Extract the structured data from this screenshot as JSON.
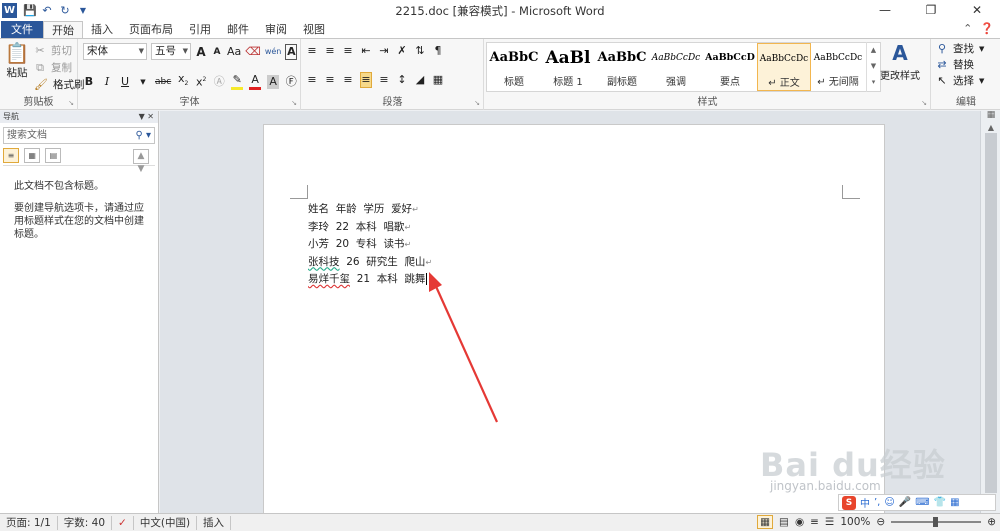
{
  "window": {
    "title": "2215.doc [兼容模式] - Microsoft Word",
    "app_icon": "W"
  },
  "tabs": [
    {
      "label": "文件"
    },
    {
      "label": "开始"
    },
    {
      "label": "插入"
    },
    {
      "label": "页面布局"
    },
    {
      "label": "引用"
    },
    {
      "label": "邮件"
    },
    {
      "label": "审阅"
    },
    {
      "label": "视图"
    }
  ],
  "ribbon": {
    "clipboard": {
      "group_label": "剪贴板",
      "paste": "粘贴",
      "cut": "剪切",
      "copy": "复制",
      "format_painter": "格式刷"
    },
    "font": {
      "group_label": "字体",
      "font_name": "宋体",
      "font_size": "五号",
      "grow": "A",
      "shrink": "A",
      "change_case": "Aa",
      "clear_format": "",
      "phonetic": "wén",
      "char_border": "A",
      "bold": "B",
      "italic": "I",
      "underline": "U",
      "strikethrough": "abc",
      "subscript": "x",
      "superscript": "x",
      "highlight_color": "#f6ea2b",
      "font_color": "#e02020"
    },
    "paragraph": {
      "group_label": "段落"
    },
    "styles": {
      "group_label": "样式",
      "items": [
        {
          "preview": "AaBbC",
          "name": "标题"
        },
        {
          "preview": "AaBl",
          "name": "标题 1"
        },
        {
          "preview": "AaBbC",
          "name": "副标题"
        },
        {
          "preview": "AaBbCcDc",
          "name": "强调"
        },
        {
          "preview": "AaBbCcD",
          "name": "要点"
        },
        {
          "preview": "AaBbCcDc",
          "name": "正文"
        },
        {
          "preview": "AaBbCcDc",
          "name": "无间隔"
        }
      ],
      "change_styles": "更改样式"
    },
    "editing": {
      "group_label": "编辑",
      "find": "查找",
      "replace": "替换",
      "select": "选择"
    }
  },
  "nav": {
    "title": "导航",
    "search_placeholder": "搜索文档",
    "msg1": "此文档不包含标题。",
    "msg2": "要创建导航选项卡，请通过应用标题样式在您的文档中创建标题。"
  },
  "document": {
    "lines": [
      {
        "name": "姓名",
        "age": "年龄",
        "edu": "学历",
        "hobby": "爱好"
      },
      {
        "name": "李玲",
        "age": "22",
        "edu": "本科",
        "hobby": "唱歌"
      },
      {
        "name": "小芳",
        "age": "20",
        "edu": "专科",
        "hobby": "读书"
      },
      {
        "name": "张科技",
        "age": "26",
        "edu": "研究生",
        "hobby": "爬山"
      },
      {
        "name": "易烊千玺",
        "age": "21",
        "edu": "本科",
        "hobby": "跳舞"
      }
    ]
  },
  "status": {
    "page": "页面: 1/1",
    "words": "字数: 40",
    "language": "中文(中国)",
    "mode": "插入",
    "zoom": "100%"
  },
  "ime": {
    "logo": "S",
    "mode": "中"
  },
  "watermark": {
    "text": "Bai du经验",
    "url": "jingyan.baidu.com"
  },
  "colors": {
    "accent": "#2b579a",
    "arrow": "#e53935"
  }
}
